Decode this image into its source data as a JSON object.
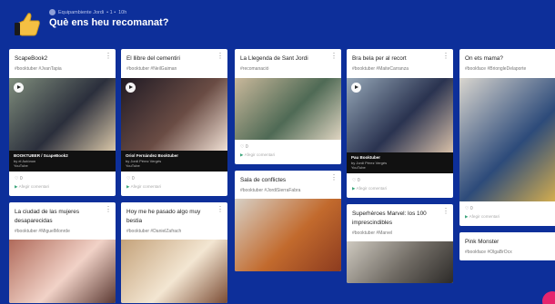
{
  "header": {
    "meta_author": "Equipambiente Jordi",
    "meta_sep": "• 1 •",
    "meta_time": "10h",
    "title": "Què ens heu recomanat?"
  },
  "columns": [
    [
      {
        "title": "ScapeBook2",
        "hashtags": "#booktuber #JvanTapia",
        "media": {
          "kind": "video",
          "height": 80,
          "colors": [
            "#7f8d7c",
            "#2b2f3c",
            "#d9c7a8"
          ],
          "yt_title": "BOOKTUBER / ScapeBook2",
          "yt_author": "by el Autónon",
          "yt_source": "YouTube"
        },
        "likes": "0",
        "comment": "Afegir comentari"
      },
      {
        "title": "La ciudad de las mujeres desaparecidas",
        "hashtags": "#booktuber #MiguelMonrde",
        "media": {
          "kind": "photo",
          "height": 70,
          "colors": [
            "#b06a5a",
            "#f1d2c7",
            "#5c3a33"
          ]
        },
        "likes": "",
        "comment": ""
      }
    ],
    [
      {
        "title": "El llibre del cementiri",
        "hashtags": "#booktuber #NeilGaiman",
        "media": {
          "kind": "video",
          "height": 80,
          "colors": [
            "#1f1a24",
            "#6a4c44",
            "#f0e0d4"
          ],
          "yt_title": "Oriol Fernández Booktuber",
          "yt_author": "by Jordi Pérez Vergés",
          "yt_source": "YouTube"
        },
        "likes": "0",
        "comment": "Afegir comentari"
      },
      {
        "title": "Hoy me he pasado algo muy bestia",
        "hashtags": "#booktuber #DanielZafrach",
        "media": {
          "kind": "photo",
          "height": 70,
          "colors": [
            "#c4a27a",
            "#f3e6d2",
            "#7b4c34"
          ]
        },
        "likes": "",
        "comment": ""
      }
    ],
    [
      {
        "title": "La Llegenda de Sant Jordi",
        "hashtags": "#recomanació",
        "media": {
          "kind": "photo",
          "height": 68,
          "colors": [
            "#c9b89b",
            "#4f6a55",
            "#e0d5c2"
          ]
        },
        "likes": "0",
        "comment": "Afegir comentari"
      },
      {
        "title": "Sala de conflictes",
        "hashtags": "#booktuber #JordiSierraFabra",
        "media": {
          "kind": "photo",
          "height": 80,
          "colors": [
            "#d7d0c6",
            "#c26a2d",
            "#8c3b1f"
          ]
        },
        "likes": "",
        "comment": ""
      }
    ],
    [
      {
        "title": "Bra bela per al recort",
        "hashtags": "#booktuber #MaiteCarranza",
        "media": {
          "kind": "video",
          "height": 82,
          "colors": [
            "#97a8b8",
            "#2a3350",
            "#d8c0a8"
          ],
          "yt_title": "Pau Booktuber",
          "yt_author": "by Jordi Pérez Vergés",
          "yt_source": "YouTube"
        },
        "likes": "0",
        "comment": "Afegir comentari"
      },
      {
        "title": "Superhèroes Marvel: los 100 imprescindibles",
        "hashtags": "#booktuber #Marvel",
        "media": {
          "kind": "photo",
          "height": 46,
          "colors": [
            "#cfcac0",
            "#6f6a63",
            "#2c2a28"
          ]
        },
        "likes": "",
        "comment": ""
      }
    ],
    [
      {
        "title": "On ets mama?",
        "hashtags": "#bookface #BriongleDelaporte",
        "media": {
          "kind": "photo",
          "height": 136,
          "colors": [
            "#d9d6cf",
            "#2d4b7a",
            "#e7b94a"
          ]
        },
        "likes": "0",
        "comment": "Afegir comentari"
      },
      {
        "title": "Pink Monster",
        "hashtags": "#bookface #OlgaBrOcx",
        "media": {
          "kind": "none",
          "height": 0,
          "colors": [
            "#fff",
            "#fff",
            "#fff"
          ]
        },
        "likes": "",
        "comment": ""
      }
    ]
  ],
  "colors": {
    "background": "#0d2f9a",
    "card": "#ffffff",
    "fab": "#e6256d",
    "accent": "#3aa57a"
  }
}
